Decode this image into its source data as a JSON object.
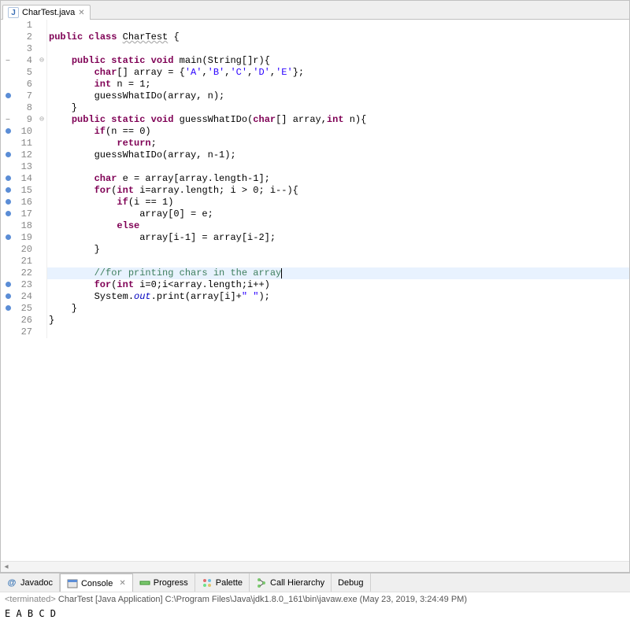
{
  "tab": {
    "label": "CharTest.java"
  },
  "code": {
    "lines": [
      {
        "n": 1,
        "marker": "",
        "fold": "",
        "html": ""
      },
      {
        "n": 2,
        "marker": "",
        "fold": "",
        "html": "<span class='kw'>public</span> <span class='kw'>class</span> <span class='cls'>CharTest</span> {"
      },
      {
        "n": 3,
        "marker": "",
        "fold": "",
        "html": ""
      },
      {
        "n": 4,
        "marker": "collapse",
        "fold": "⊖",
        "html": "    <span class='kw'>public</span> <span class='kw'>static</span> <span class='kw'>void</span> main(String[]r){"
      },
      {
        "n": 5,
        "marker": "",
        "fold": "",
        "html": "        <span class='typ'>char</span>[] array = {<span class='str'>'A'</span>,<span class='str'>'B'</span>,<span class='str'>'C'</span>,<span class='str'>'D'</span>,<span class='str'>'E'</span>};"
      },
      {
        "n": 6,
        "marker": "",
        "fold": "",
        "html": "        <span class='typ'>int</span> n = 1;"
      },
      {
        "n": 7,
        "marker": "dot",
        "fold": "",
        "html": "        <span>guessWhatIDo</span>(array, n);"
      },
      {
        "n": 8,
        "marker": "",
        "fold": "",
        "html": "    }"
      },
      {
        "n": 9,
        "marker": "collapse",
        "fold": "⊖",
        "html": "    <span class='kw'>public</span> <span class='kw'>static</span> <span class='kw'>void</span> guessWhatIDo(<span class='typ'>char</span>[] array,<span class='typ'>int</span> n){"
      },
      {
        "n": 10,
        "marker": "dot",
        "fold": "",
        "html": "        <span class='kw'>if</span>(n == 0)"
      },
      {
        "n": 11,
        "marker": "",
        "fold": "",
        "html": "            <span class='kw'>return</span>;"
      },
      {
        "n": 12,
        "marker": "dot",
        "fold": "",
        "html": "        <span>guessWhatIDo</span>(array, n-1);"
      },
      {
        "n": 13,
        "marker": "",
        "fold": "",
        "html": ""
      },
      {
        "n": 14,
        "marker": "dot",
        "fold": "",
        "html": "        <span class='typ'>char</span> e = array[array.length-1];"
      },
      {
        "n": 15,
        "marker": "dot",
        "fold": "",
        "html": "        <span class='kw'>for</span>(<span class='typ'>int</span> i=array.length; i &gt; 0; i--){"
      },
      {
        "n": 16,
        "marker": "dot",
        "fold": "",
        "html": "            <span class='kw'>if</span>(i == 1)"
      },
      {
        "n": 17,
        "marker": "dot",
        "fold": "",
        "html": "                array[0] = e;"
      },
      {
        "n": 18,
        "marker": "",
        "fold": "",
        "html": "            <span class='kw'>else</span>"
      },
      {
        "n": 19,
        "marker": "dot",
        "fold": "",
        "html": "                array[i-1] = array[i-2];"
      },
      {
        "n": 20,
        "marker": "",
        "fold": "",
        "html": "        }"
      },
      {
        "n": 21,
        "marker": "",
        "fold": "",
        "html": ""
      },
      {
        "n": 22,
        "marker": "",
        "fold": "",
        "hl": true,
        "html": "        <span class='cmt'>//for printing chars in the array</span><span class='caret'></span>"
      },
      {
        "n": 23,
        "marker": "dot",
        "fold": "",
        "html": "        <span class='kw'>for</span>(<span class='typ'>int</span> i=0;i&lt;array.length;i++)"
      },
      {
        "n": 24,
        "marker": "dot",
        "fold": "",
        "html": "        System.<span class='fld'>out</span>.print(array[i]+<span class='str'>\" \"</span>);"
      },
      {
        "n": 25,
        "marker": "dot",
        "fold": "",
        "html": "    }"
      },
      {
        "n": 26,
        "marker": "",
        "fold": "",
        "html": "}"
      },
      {
        "n": 27,
        "marker": "",
        "fold": "",
        "html": ""
      }
    ]
  },
  "bottom_tabs": {
    "javadoc": {
      "label": "Javadoc"
    },
    "console": {
      "label": "Console"
    },
    "progress": {
      "label": "Progress"
    },
    "palette": {
      "label": "Palette"
    },
    "callhier": {
      "label": "Call Hierarchy"
    },
    "debug": {
      "label": "Debug"
    }
  },
  "console": {
    "status_prefix": "<terminated>",
    "status_text": " CharTest [Java Application] C:\\Program Files\\Java\\jdk1.8.0_161\\bin\\javaw.exe (May 23, 2019, 3:24:49 PM)",
    "output": "E A B C D"
  }
}
